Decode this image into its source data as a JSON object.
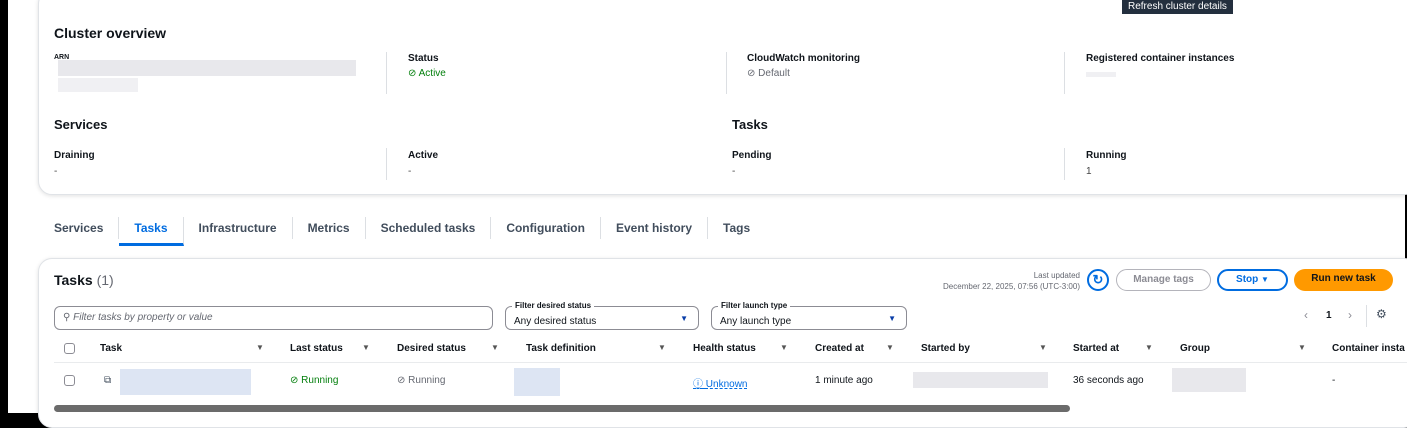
{
  "tooltip": "Refresh cluster details",
  "overview": {
    "title": "Cluster overview",
    "arn_label": "ARN",
    "status_label": "Status",
    "status_value": "Active",
    "cloudwatch_label": "CloudWatch monitoring",
    "cloudwatch_value": "Default",
    "registered_label": "Registered container instances",
    "services_title": "Services",
    "draining_label": "Draining",
    "draining_value": "-",
    "active_label": "Active",
    "active_value": "-",
    "tasks_title": "Tasks",
    "pending_label": "Pending",
    "pending_value": "-",
    "running_label": "Running",
    "running_value": "1"
  },
  "tabs": [
    "Services",
    "Tasks",
    "Infrastructure",
    "Metrics",
    "Scheduled tasks",
    "Configuration",
    "Event history",
    "Tags"
  ],
  "tasks": {
    "title": "Tasks",
    "count": "(1)",
    "last_updated_label": "Last updated",
    "last_updated": "December 22, 2025, 07:56 (UTC-3:00)",
    "manage_tags": "Manage tags",
    "stop": "Stop",
    "run_new": "Run new task",
    "search_placeholder": "Filter tasks by property or value",
    "filter_status_label": "Filter desired status",
    "filter_status_value": "Any desired status",
    "filter_launch_label": "Filter launch type",
    "filter_launch_value": "Any launch type",
    "page": "1",
    "columns": [
      "Task",
      "Last status",
      "Desired status",
      "Task definition",
      "Health status",
      "Created at",
      "Started by",
      "Started at",
      "Group",
      "Container insta"
    ],
    "row": {
      "last_status": "Running",
      "desired_status": "Running",
      "health": "Unknown",
      "created": "1 minute ago",
      "started_at": "36 seconds ago",
      "container": "-"
    }
  },
  "colors": {
    "primary": "#006ce0",
    "accent": "#ff9900",
    "success": "#037f0c"
  }
}
